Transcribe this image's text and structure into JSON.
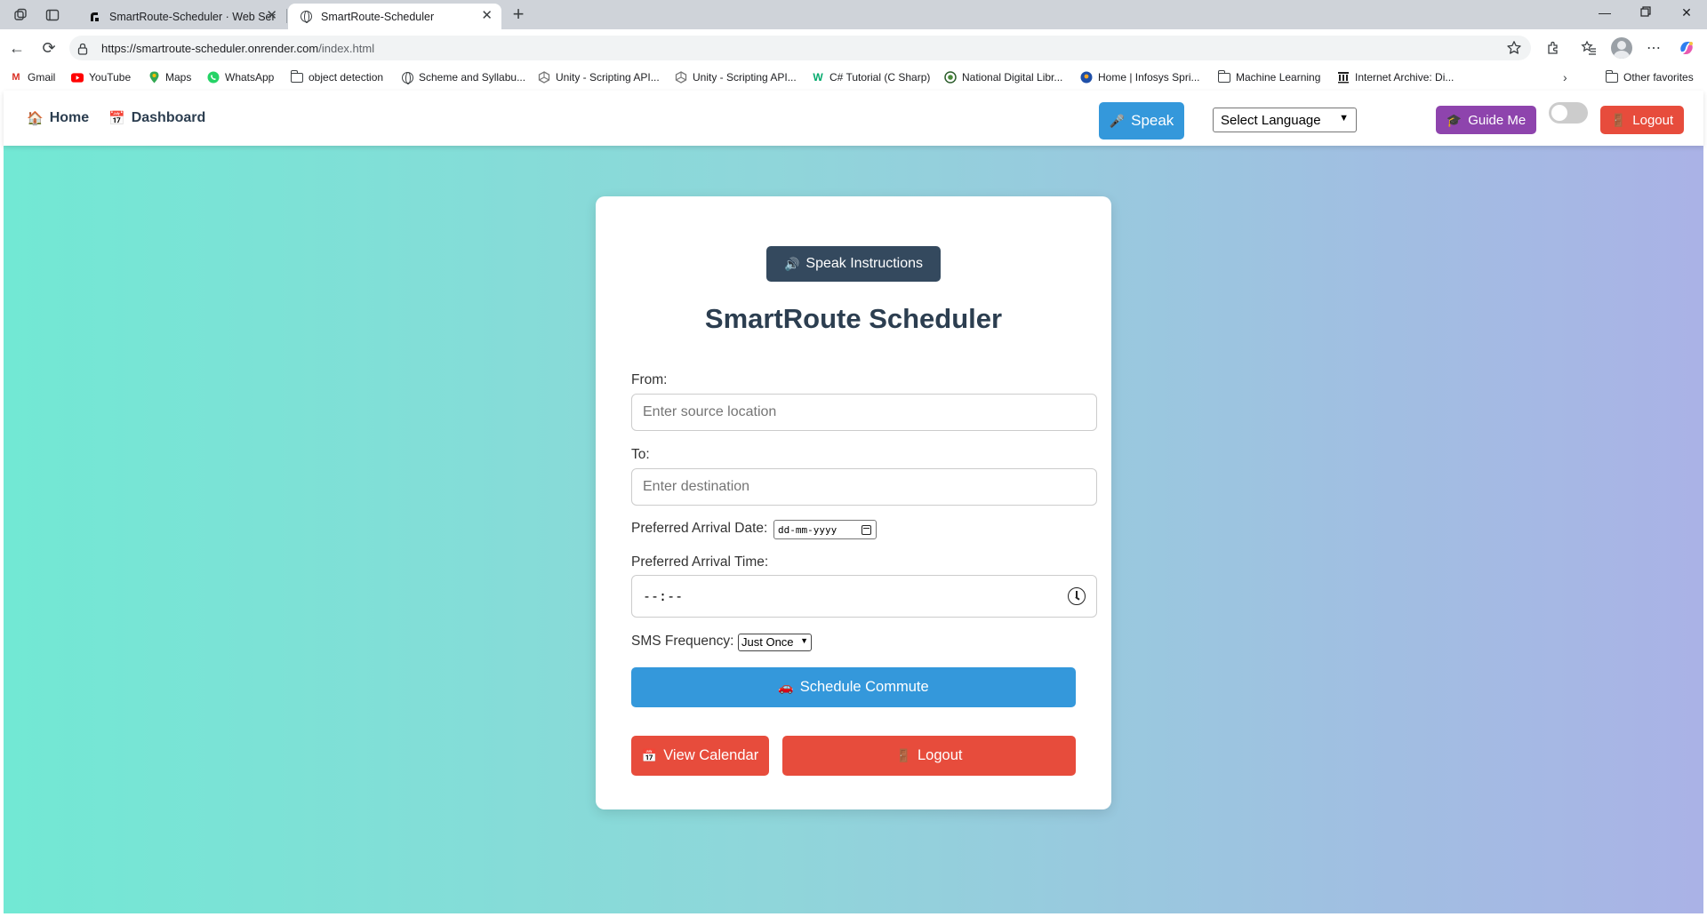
{
  "browser": {
    "tabs": [
      {
        "title": "SmartRoute-Scheduler · Web Ser",
        "icon": "render-icon"
      },
      {
        "title": "SmartRoute-Scheduler",
        "icon": "globe-icon"
      }
    ],
    "url_host": "https://smartroute-scheduler.onrender.com",
    "url_path": "/index.html",
    "bookmarks": [
      {
        "label": "Gmail"
      },
      {
        "label": "YouTube"
      },
      {
        "label": "Maps"
      },
      {
        "label": "WhatsApp"
      },
      {
        "label": "object detection"
      },
      {
        "label": "Scheme and Syllabu..."
      },
      {
        "label": "Unity - Scripting API..."
      },
      {
        "label": "Unity - Scripting API..."
      },
      {
        "label": "C# Tutorial (C Sharp)"
      },
      {
        "label": "National Digital Libr..."
      },
      {
        "label": "Home | Infosys Spri..."
      },
      {
        "label": "Machine Learning"
      },
      {
        "label": "Internet Archive: Di..."
      }
    ],
    "other_favorites": "Other favorites"
  },
  "nav": {
    "home": "Home",
    "home_icon": "🏠",
    "dashboard": "Dashboard",
    "dashboard_icon": "📅",
    "speak": "Speak",
    "speak_icon": "🎤",
    "language_select": "Select Language",
    "guide": "Guide Me",
    "guide_icon": "🎓",
    "logout": "Logout",
    "logout_icon": "🚪",
    "dark_mode_on": false
  },
  "form": {
    "speak_instructions": "Speak Instructions",
    "speak_instructions_icon": "🔊",
    "title": "SmartRoute Scheduler",
    "from_label": "From:",
    "from_placeholder": "Enter source location",
    "to_label": "To:",
    "to_placeholder": "Enter destination",
    "date_label": "Preferred Arrival Date:",
    "date_value": "dd-mm-yyyy",
    "time_label": "Preferred Arrival Time:",
    "time_value": "--:--",
    "sms_label": "SMS Frequency:",
    "sms_value": "Just Once",
    "schedule_button": "Schedule Commute",
    "schedule_icon": "🚗",
    "view_calendar": "View Calendar",
    "view_calendar_icon": "📅",
    "logout": "Logout",
    "logout_icon": "🚪"
  },
  "colors": {
    "primary_blue": "#3498db",
    "danger_red": "#e74c3c",
    "purple": "#8e44ad",
    "dark_slate": "#34495e",
    "title_color": "#2c3e50",
    "gradient_start": "#72e8d4",
    "gradient_end": "#aab2e6"
  }
}
